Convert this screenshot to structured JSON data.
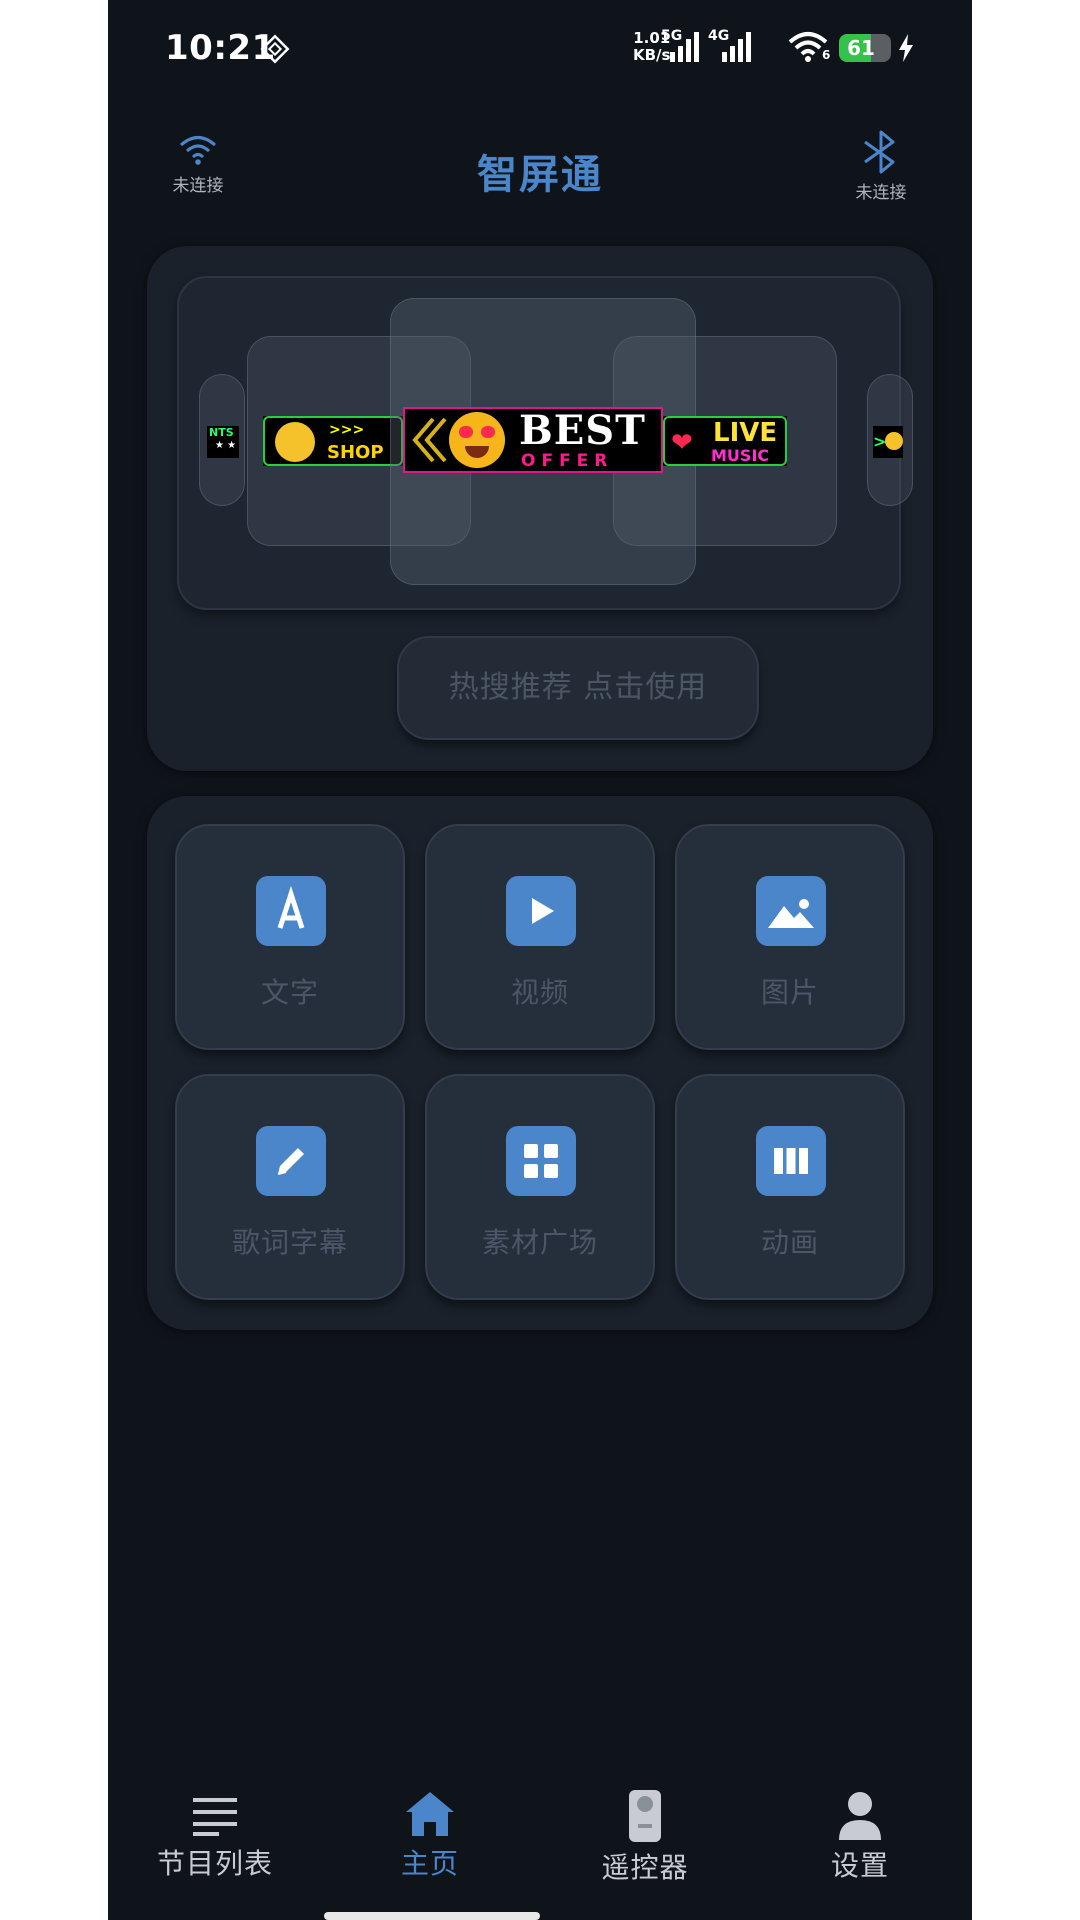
{
  "status_bar": {
    "time": "10:21",
    "net_speed_value": "1.01",
    "net_speed_unit": "KB/s",
    "signal1_label": "5G",
    "signal2_label": "4G",
    "wifi_badge": "6",
    "battery_percent": "61",
    "battery_level": 0.61,
    "icons": [
      "vpn-icon",
      "signal-icon",
      "wifi-icon",
      "battery-icon",
      "charging-icon"
    ]
  },
  "header": {
    "title": "智屏通",
    "wifi_status": "未连接",
    "bluetooth_status": "未连接",
    "colors": {
      "accent": "#4a86c9",
      "background": "#0f141b"
    }
  },
  "carousel": {
    "banners": [
      {
        "name": "banner-points",
        "text": "NTS"
      },
      {
        "name": "banner-shop",
        "text": "SHOP"
      },
      {
        "name": "banner-best-offer",
        "text_main": "BEST",
        "text_sub": "OFFER"
      },
      {
        "name": "banner-live-music",
        "text_main": "LIVE",
        "text_sub": "MUSIC"
      }
    ],
    "hot_button": "热搜推荐 点击使用"
  },
  "features": [
    {
      "label": "文字",
      "icon": "text-a-icon"
    },
    {
      "label": "视频",
      "icon": "play-icon"
    },
    {
      "label": "图片",
      "icon": "image-icon"
    },
    {
      "label": "歌词字幕",
      "icon": "pencil-icon"
    },
    {
      "label": "素材广场",
      "icon": "grid-icon"
    },
    {
      "label": "动画",
      "icon": "columns-icon"
    }
  ],
  "nav": [
    {
      "label": "节目列表",
      "icon": "list-icon"
    },
    {
      "label": "主页",
      "icon": "home-icon",
      "active": true
    },
    {
      "label": "遥控器",
      "icon": "remote-icon"
    },
    {
      "label": "设置",
      "icon": "user-icon"
    }
  ]
}
